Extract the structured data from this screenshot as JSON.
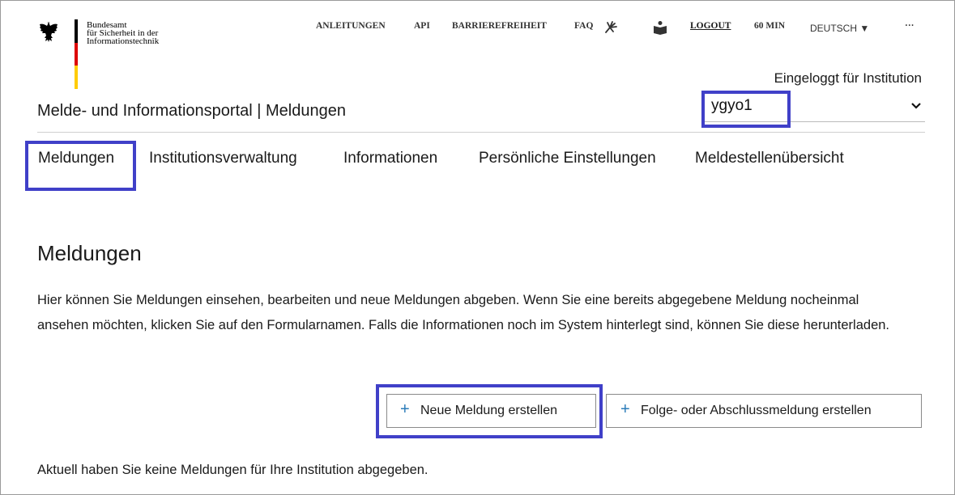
{
  "brand": {
    "agency_lines": [
      "Bundesamt",
      "für Sicherheit in der",
      "Informationstechnik"
    ],
    "flag_colors": [
      "#000000",
      "#dd0000",
      "#ffcc00"
    ]
  },
  "topnav": {
    "items": [
      "ANLEITUNGEN",
      "API",
      "BARRIEREFREIHEIT",
      "FAQ"
    ],
    "icons": [
      "sign-language-icon",
      "easy-language-icon"
    ],
    "logout": "LOGOUT",
    "session_timer": "60 MIN",
    "language": "DEUTSCH ▼",
    "more": "···"
  },
  "institution": {
    "label": "Eingeloggt für Institution",
    "selected": "ygyo1"
  },
  "header": {
    "title": "Melde- und Informationsportal | Meldungen"
  },
  "main_nav": {
    "tabs": [
      "Meldungen",
      "Institutionsverwaltung",
      "Informationen",
      "Persönliche Einstellungen",
      "Meldestellenübersicht"
    ]
  },
  "content": {
    "heading": "Meldungen",
    "description": "Hier können Sie Meldungen einsehen, bearbeiten und neue Meldungen abgeben. Wenn Sie eine bereits abgegebene Meldung nocheinmal ansehen möchten, klicken Sie auf den Formularnamen. Falls die Informationen noch im System hinterlegt sind, können Sie diese herunterladen.",
    "new_report_button": "Neue Meldung erstellen",
    "followup_button": "Folge- oder Abschlussmeldung erstellen",
    "plus": "+",
    "empty_message": "Aktuell haben Sie keine Meldungen für Ihre Institution abgegeben."
  },
  "highlight_color": "#4040c8"
}
